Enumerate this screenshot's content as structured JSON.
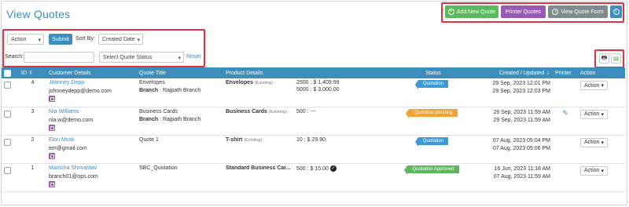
{
  "page": {
    "title": "View Quotes"
  },
  "toolbar": {
    "add_new_quote": "Add New Quote",
    "printer_quotes": "Printer Quotes",
    "view_quote_form": "View Quote Form",
    "info_icon": "info-icon"
  },
  "filters": {
    "action_select": "Action",
    "submit_label": "Submit",
    "sort_by_label": "Sort By:",
    "sort_select": "Created Date",
    "search_label": "Search:",
    "search_value": "",
    "status_select": "Select Quote Status",
    "reset_label": "Reset"
  },
  "table": {
    "headers": {
      "id": "ID",
      "customer": "Customer Details",
      "quote_title": "Quote Title",
      "product": "Product Details",
      "status": "Status",
      "created": "Created / Updated",
      "printer": "Printer",
      "action": "Action"
    },
    "rows": [
      {
        "id": "4",
        "name": "Johnney Depp",
        "email": "johnneydepp@demo.com",
        "title": "Envelopes",
        "branch_label": "Branch",
        "branch_value": ": Rajpath Branch",
        "product": "Envelopes",
        "product_note": "(Existing) :",
        "qty_line1": "2500 : $ 1,409.99",
        "qty_line2": "5000 : $ 3,000.00",
        "status": "Quotation",
        "created": "29 Sep, 2023 12:01 PM",
        "updated": "29 Sep, 2023 12:03 PM",
        "action": "Action"
      },
      {
        "id": "3",
        "name": "Nia Williams",
        "email": "nia.w@demo.com",
        "title": "Business Cards",
        "branch_label": "Branch",
        "branch_value": ": Rajpath Branch",
        "product": "Business Cards",
        "product_note": "(Existing) :",
        "qty_line1": "500 : ---",
        "qty_line2": "",
        "status": "Quotation pending",
        "created": "29 Sep, 2023 11:59 AM",
        "updated": "29 Sep, 2023 11:59 AM",
        "action": "Action"
      },
      {
        "id": "2",
        "name": "Elon Musk",
        "email": "em@gmail.com",
        "title": "Quote 1",
        "branch_label": "",
        "branch_value": "",
        "product": "T-shirt",
        "product_note": "(Existing) :",
        "qty_line1": "10 : $ 29.90",
        "qty_line2": "",
        "status": "Quotation",
        "created": "07 Aug, 2023 05:04 PM",
        "updated": "07 Aug, 2023 05:06 PM",
        "action": "Action"
      },
      {
        "id": "1",
        "name": "Manisha Shrivastav",
        "email": "branch01@ops.com",
        "title": "SBC_Quotation",
        "branch_label": "",
        "branch_value": "",
        "product": "Standard Business Car...",
        "product_note": "",
        "qty_line1": "500 : $ 15.00",
        "qty_line2": "",
        "status": "Quotation Approved",
        "created": "16 Jun, 2023 11:18 AM",
        "updated": "07 Aug, 2023 11:59 AM",
        "action": "Action"
      }
    ]
  },
  "colors": {
    "header_blue": "#3c8dbc",
    "highlight_red": "#e0323e",
    "status_blue": "#3c9ad6",
    "status_orange": "#f0a332",
    "status_green": "#5cb85c"
  }
}
